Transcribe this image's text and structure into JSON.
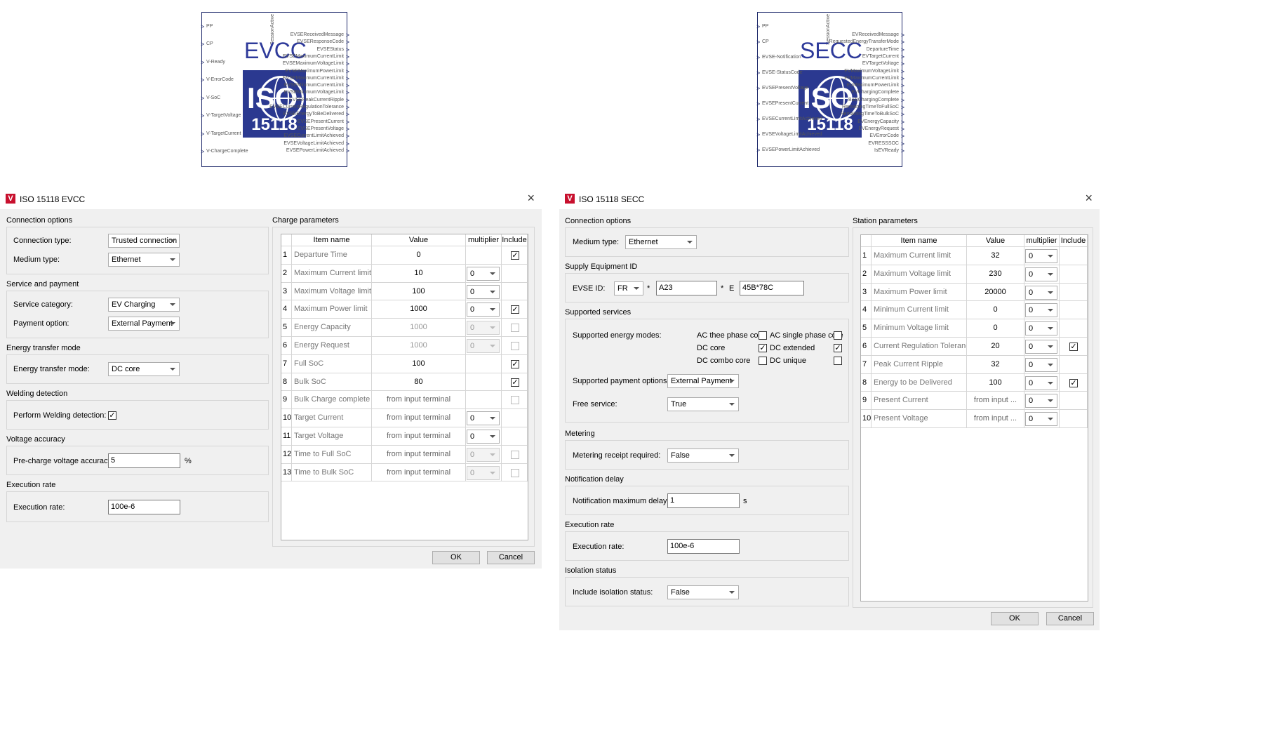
{
  "evcc_block": {
    "title": "EVCC",
    "logo_text": "ISO",
    "logo_number": "15118",
    "top_port": "SessionActive",
    "inputs": [
      "PP",
      "CP",
      "V-Ready",
      "V-ErrorCode",
      "V-SoC",
      "V-TargetVoltage",
      "V-TargetCurrent",
      "V-ChargeComplete"
    ],
    "outputs": [
      "EVSEReceivedMessage",
      "EVSEResponseCode",
      "EVSEStatus",
      "EVSEMaximumCurrentLimit",
      "EVSEMaximumVoltageLimit",
      "EVSEMaximumPowerLimit",
      "EVSEMaximumCurrentLimit",
      "EVSEMinimumCurrentLimit",
      "EVSEMinimumVoltageLimit",
      "EVSEPeakCurrentRipple",
      "EVSECurrentRegulationTolerance",
      "EVSEEnergyToBeDelivered",
      "EVSEPresentCurrent",
      "EVSEPresentVoltage",
      "EVSECurrentLimitAchieved",
      "EVSEVoltageLimitAchieved",
      "EVSEPowerLimitAchieved"
    ]
  },
  "secc_block": {
    "title": "SECC",
    "logo_text": "ISO",
    "logo_number": "15118",
    "top_port": "SessionActive",
    "inputs": [
      "PP",
      "CP",
      "EVSE-Notification",
      "EVSE-StatusCode",
      "EVSEPresentVoltage",
      "EVSEPresentCurrent",
      "EVSECurrentLimitAchieved",
      "EVSEVoltageLimitAchieved",
      "EVSEPowerLimitAchieved"
    ],
    "outputs": [
      "EVReceivedMessage",
      "RequestedEnergyTransferMode",
      "DepartureTime",
      "EVTargetCurrent",
      "EVTargetVoltage",
      "EVMaximumVoltageLimit",
      "EVMaximumCurrentLimit",
      "EVMaximumPowerLimit",
      "EVChargingComplete",
      "BulkChargingComplete",
      "RemainingTimeToFullSoC",
      "RemainingTimeToBulkSoC",
      "EVEnergyCapacity",
      "EVEnergyRequest",
      "EVErrorCode",
      "EVRESSSOC",
      "IsEVReady"
    ]
  },
  "evcc_dialog": {
    "title": "ISO 15118 EVCC",
    "close": "×",
    "sections": {
      "connection": "Connection options",
      "service": "Service and payment",
      "energy": "Energy transfer mode",
      "welding": "Welding detection",
      "voltage": "Voltage accuracy",
      "exec": "Execution rate",
      "charge": "Charge parameters"
    },
    "fields": {
      "connection_type_label": "Connection type:",
      "connection_type": "Trusted connection",
      "medium_type_label": "Medium type:",
      "medium_type": "Ethernet",
      "service_category_label": "Service category:",
      "service_category": "EV Charging",
      "payment_option_label": "Payment option:",
      "payment_option": "External Payment",
      "energy_mode_label": "Energy transfer mode:",
      "energy_mode": "DC core",
      "welding_label": "Perform Welding detection:",
      "welding_checked": "✓",
      "precharge_label": "Pre-charge voltage accuracy:",
      "precharge_value": "5",
      "precharge_unit": "%",
      "exec_label": "Execution rate:",
      "exec_value": "100e-6"
    },
    "table": {
      "headers": [
        "Item name",
        "Value",
        "multiplier",
        "Include"
      ],
      "rows": [
        {
          "n": "1",
          "name": "Departure Time",
          "value": "0",
          "mult": "",
          "include": "✓"
        },
        {
          "n": "2",
          "name": "Maximum Current limit",
          "value": "10",
          "mult": "0",
          "include": ""
        },
        {
          "n": "3",
          "name": "Maximum Voltage limit",
          "value": "100",
          "mult": "0",
          "include": ""
        },
        {
          "n": "4",
          "name": "Maximum Power limit",
          "value": "1000",
          "mult": "0",
          "include": "✓"
        },
        {
          "n": "5",
          "name": "Energy Capacity",
          "value": "1000",
          "mult": "0",
          "include": ""
        },
        {
          "n": "6",
          "name": "Energy Request",
          "value": "1000",
          "mult": "0",
          "include": ""
        },
        {
          "n": "7",
          "name": "Full SoC",
          "value": "100",
          "mult": "",
          "include": "✓"
        },
        {
          "n": "8",
          "name": "Bulk SoC",
          "value": "80",
          "mult": "",
          "include": "✓"
        },
        {
          "n": "9",
          "name": "Bulk Charge complete",
          "value": "from input terminal",
          "mult": "",
          "include": ""
        },
        {
          "n": "10",
          "name": "Target Current",
          "value": "from input terminal",
          "mult": "0",
          "include": ""
        },
        {
          "n": "11",
          "name": "Target Voltage",
          "value": "from input terminal",
          "mult": "0",
          "include": ""
        },
        {
          "n": "12",
          "name": "Time to Full SoC",
          "value": "from input terminal",
          "mult": "0",
          "include": ""
        },
        {
          "n": "13",
          "name": "Time to Bulk SoC",
          "value": "from input terminal",
          "mult": "0",
          "include": ""
        }
      ]
    },
    "ok": "OK",
    "cancel": "Cancel"
  },
  "secc_dialog": {
    "title": "ISO 15118 SECC",
    "close": "×",
    "sections": {
      "connection": "Connection options",
      "supply": "Supply Equipment ID",
      "services": "Supported services",
      "metering": "Metering",
      "notification": "Notification delay",
      "exec": "Execution rate",
      "isolation": "Isolation status",
      "station": "Station parameters"
    },
    "fields": {
      "medium_type_label": "Medium type:",
      "medium_type": "Ethernet",
      "evse_id_label": "EVSE ID:",
      "evse_country": "FR",
      "evse_star1": "*",
      "evse_operator": "A23",
      "evse_star2": "*",
      "evse_e": "E",
      "evse_id": "45B*78C",
      "energy_modes_label": "Supported energy modes:",
      "ac_three": "AC thee phase core",
      "ac_single": "AC single phase core",
      "dc_core": "DC core",
      "dc_extended": "DC extended",
      "dc_combo": "DC combo core",
      "dc_unique": "DC unique",
      "check": "✓",
      "payment_label": "Supported payment options:",
      "payment_value": "External Payment",
      "free_label": "Free service:",
      "free_value": "True",
      "metering_label": "Metering receipt required:",
      "metering_value": "False",
      "notif_label": "Notification maximum delay:",
      "notif_value": "1",
      "notif_unit": "s",
      "exec_label": "Execution rate:",
      "exec_value": "100e-6",
      "isolation_label": "Include isolation status:",
      "isolation_value": "False"
    },
    "table": {
      "headers": [
        "Item name",
        "Value",
        "multiplier",
        "Include"
      ],
      "rows": [
        {
          "n": "1",
          "name": "Maximum Current limit",
          "value": "32",
          "mult": "0",
          "include": ""
        },
        {
          "n": "2",
          "name": "Maximum Voltage limit",
          "value": "230",
          "mult": "0",
          "include": ""
        },
        {
          "n": "3",
          "name": "Maximum Power limit",
          "value": "20000",
          "mult": "0",
          "include": ""
        },
        {
          "n": "4",
          "name": "Minimum Current limit",
          "value": "0",
          "mult": "0",
          "include": ""
        },
        {
          "n": "5",
          "name": "Minimum Voltage limit",
          "value": "0",
          "mult": "0",
          "include": ""
        },
        {
          "n": "6",
          "name": "Current Regulation Tolerance",
          "value": "20",
          "mult": "0",
          "include": "✓"
        },
        {
          "n": "7",
          "name": "Peak Current Ripple",
          "value": "32",
          "mult": "0",
          "include": ""
        },
        {
          "n": "8",
          "name": "Energy to be Delivered",
          "value": "100",
          "mult": "0",
          "include": "✓"
        },
        {
          "n": "9",
          "name": "Present Current",
          "value": "from input ...",
          "mult": "0",
          "include": ""
        },
        {
          "n": "10",
          "name": "Present Voltage",
          "value": "from input ...",
          "mult": "0",
          "include": ""
        }
      ]
    },
    "ok": "OK",
    "cancel": "Cancel"
  }
}
